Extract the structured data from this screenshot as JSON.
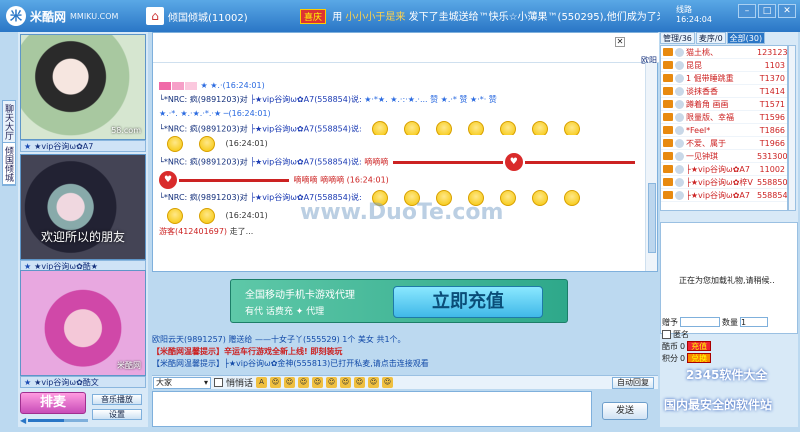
{
  "app": {
    "logo_mark": "米",
    "name": "米酷网",
    "domain": "MMIKU.COM"
  },
  "room": {
    "title": "倾国倾城(11002)"
  },
  "marquee": {
    "badge": "喜庆",
    "prefix": "用",
    "highlight": "小小小于是来",
    "text": "发下了圭城送给™快乐☆小薄果™(550295),他们成为了米酷"
  },
  "clock": {
    "label": "线路",
    "time": "16:24:04"
  },
  "sidetabs": [
    "聊天大厅",
    "倾国倾城"
  ],
  "videos": [
    {
      "wm": "58.com",
      "caption": ""
    },
    {
      "wm": "",
      "caption": "欢迎所以的朋友"
    },
    {
      "wm": "米酷网",
      "caption": ""
    }
  ],
  "video_bars": [
    "★vip谷询ω✿A7",
    "★vip谷询ω✿酷★",
    "★vip谷询ω✿酷文"
  ],
  "controls": {
    "paimai": "排麦",
    "music": "音乐播放",
    "settings": "设置"
  },
  "volume": {
    "level": 0.6
  },
  "chat": {
    "ouhe": "欧阳",
    "messages": [
      {
        "user": "",
        "to": "",
        "said": "",
        "content": "★ ★.·(16:24:01)"
      },
      {
        "user": "└*NRC: 疯(9891203)对",
        "to": "├★vip谷询ω✿A7(558854)说:",
        "said": "",
        "content": "★·*★. ★.·:·★.·... 赞 ★.·* 赞 ★·*· 赞"
      },
      {
        "user": "",
        "to": "",
        "said": "",
        "content": "★.·*. ★.·★.·*.·★ ─(16:24:01)"
      },
      {
        "user": "└*NRC: 疯(9891203)对",
        "to": "├★vip谷询ω✿A7(558854)说:",
        "said": "",
        "content": ""
      },
      {
        "user": "",
        "to": "",
        "said": "",
        "content": "(16:24:01)"
      },
      {
        "user": "└*NRC: 疯(9891203)对",
        "to": "├★vip谷询ω✿A7(558854)说:",
        "said": "",
        "content": "嘀嘀嘀"
      },
      {
        "user": "",
        "to": "",
        "said": "",
        "content": "嘀嘀嘀 嘀嘀嘀 (16:24:01)"
      },
      {
        "user": "└*NRC: 疯(9891203)对",
        "to": "├★vip谷询ω✿A7(558854)说:",
        "said": "",
        "content": ""
      },
      {
        "user": "",
        "to": "",
        "said": "",
        "content": "(16:24:01)"
      },
      {
        "user": "游客(412401697)",
        "to": "",
        "said": "",
        "content": "走了..."
      }
    ],
    "times": [
      "(16:24:01)",
      "(16:24:01)",
      "(16:24:01)",
      "(16:24:01)"
    ]
  },
  "banner": {
    "line1": "全国移动手机卡游戏代理",
    "line2": "有代 话费充 ✦ 代理",
    "cta": "立即充值"
  },
  "notices": [
    {
      "text": "欧阳云天(9891257)  赠送给 ——十女子丫(555529)  1个 美女 共1个。"
    },
    {
      "text": "【米酷网温馨提示】辛运车行游戏全新上线! 即刻装玩"
    },
    {
      "text": "【米酷网温馨提示】├★vip谷询ω✿金神(555813)已打开私麦,请点击连接观看"
    }
  ],
  "toolbar": {
    "target": "大家",
    "private_label": "悄悄话",
    "icons": [
      "A",
      "☺",
      "☺",
      "☺",
      "☺",
      "☺",
      "☺",
      "☺",
      "☺",
      "☺"
    ],
    "autoreply": "自动回复"
  },
  "send": "发送",
  "right": {
    "tabs": [
      "管理/36",
      "麦序/0",
      "全部(30)"
    ],
    "users": [
      {
        "name": "猫土桃、",
        "id": "123123"
      },
      {
        "name": "昆昆",
        "id": "1103"
      },
      {
        "name": "1 倔带睡跳重",
        "id": "T1370"
      },
      {
        "name": "谈抹香香",
        "id": "T1414"
      },
      {
        "name": "蹲着角 画画",
        "id": "T1571"
      },
      {
        "name": "限量版、幸福",
        "id": "T1596"
      },
      {
        "name": "*Feel*",
        "id": "T1866"
      },
      {
        "name": "不爱、属于",
        "id": "T1966"
      },
      {
        "name": "一见钟琪",
        "id": "531300"
      },
      {
        "name": "├★vip谷询ω✿A7",
        "id": "11002"
      },
      {
        "name": "├★vip谷询ω✿梓Ⅴ",
        "id": "558850"
      },
      {
        "name": "├★vip谷询ω✿A7",
        "id": "558854"
      }
    ],
    "loading": "正在为您加载礼物,请稍候..",
    "gift": {
      "to_label": "赠予",
      "qty_label": "数量",
      "qty": "1",
      "anon": "匿名",
      "coins_label": "酷币",
      "coins": "0",
      "credit_label": "积分",
      "credit": "0",
      "recharge": "充值",
      "exchange": "兑换"
    }
  },
  "watermarks": {
    "center": "www.DuoTe.com",
    "corner1": "2345软件大全",
    "corner2": "国内最安全的软件站"
  }
}
